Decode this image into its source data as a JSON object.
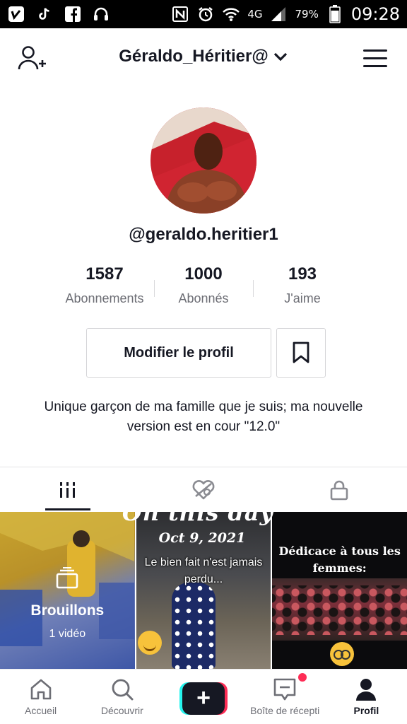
{
  "status_bar": {
    "network": "4G",
    "battery": "79%",
    "time": "09:28",
    "icons": [
      "vimeo-icon",
      "tiktok-icon",
      "facebook-icon",
      "headset-icon",
      "nfc-icon",
      "alarm-icon",
      "wifi-icon",
      "signal-icon",
      "battery-icon"
    ]
  },
  "header": {
    "username": "Géraldo_Héritier@",
    "add_user_icon": "add-user-icon",
    "menu_icon": "hamburger-menu-icon"
  },
  "profile": {
    "handle": "@geraldo.heritier1",
    "stats": [
      {
        "value": "1587",
        "label": "Abonnements"
      },
      {
        "value": "1000",
        "label": "Abonnés"
      },
      {
        "value": "193",
        "label": "J'aime"
      }
    ],
    "edit_button": "Modifier le profil",
    "bio": "Unique garçon de ma famille que je suis; ma nouvelle version est en cour \"12.0\""
  },
  "tabs": [
    {
      "icon": "grid-icon",
      "active": true
    },
    {
      "icon": "liked-heart-icon",
      "active": false
    },
    {
      "icon": "lock-icon",
      "active": false
    }
  ],
  "overlay": {
    "title": "On this day",
    "date": "Oct 9, 2021"
  },
  "videos": {
    "drafts": {
      "title": "Brouillons",
      "count": "1 vidéo"
    },
    "video2_caption": "Le bien fait n'est jamais perdu...",
    "video3_caption": "Dédicace à tous les femmes:"
  },
  "bottom_nav": [
    {
      "label": "Accueil",
      "icon": "home-icon"
    },
    {
      "label": "Découvrir",
      "icon": "search-icon"
    },
    {
      "label": "",
      "icon": "plus-icon"
    },
    {
      "label": "Boîte de récepti",
      "icon": "inbox-icon"
    },
    {
      "label": "Profil",
      "icon": "profile-icon"
    }
  ],
  "colors": {
    "accent_red": "#fe2c55",
    "accent_cyan": "#25f4ee",
    "text_primary": "#161823",
    "text_secondary": "#6d6e75"
  }
}
